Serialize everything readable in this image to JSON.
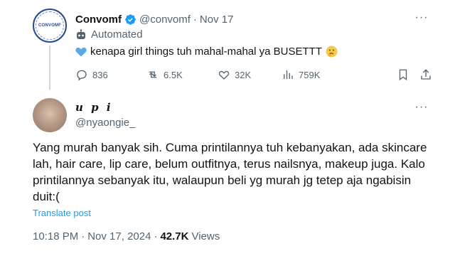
{
  "parent_tweet": {
    "display_name": "Convomf",
    "avatar_text": "CONVOMF",
    "handle": "@convomf",
    "separator": "·",
    "date": "Nov 17",
    "automated_label": "Automated",
    "text": "kenapa girl things tuh mahal-mahal ya BUSETTT",
    "stats": {
      "replies": "836",
      "reposts": "6.5K",
      "likes": "32K",
      "views": "759K"
    },
    "colors": {
      "verified": "#1d9bf0",
      "heart": "#5aa9e6"
    }
  },
  "reply_tweet": {
    "display_name": "u p i",
    "handle": "@nyaongie_",
    "text": "Yang murah banyak sih. Cuma printilannya tuh kebanyakan, ada skincare lah, hair care, lip care, belum outfitnya, terus nailsnya, makeup juga. Kalo printilannya sebanyak itu, walaupun beli yg murah jg tetep aja ngabisin duit:(",
    "translate_label": "Translate post",
    "time": "10:18 PM",
    "separator": "·",
    "date": "Nov 17, 2024",
    "meta_separator": "·",
    "views_count": "42.7K",
    "views_label": "Views"
  },
  "colors": {
    "accent": "#1d9bf0",
    "muted": "#536471",
    "text": "#0f1419"
  }
}
